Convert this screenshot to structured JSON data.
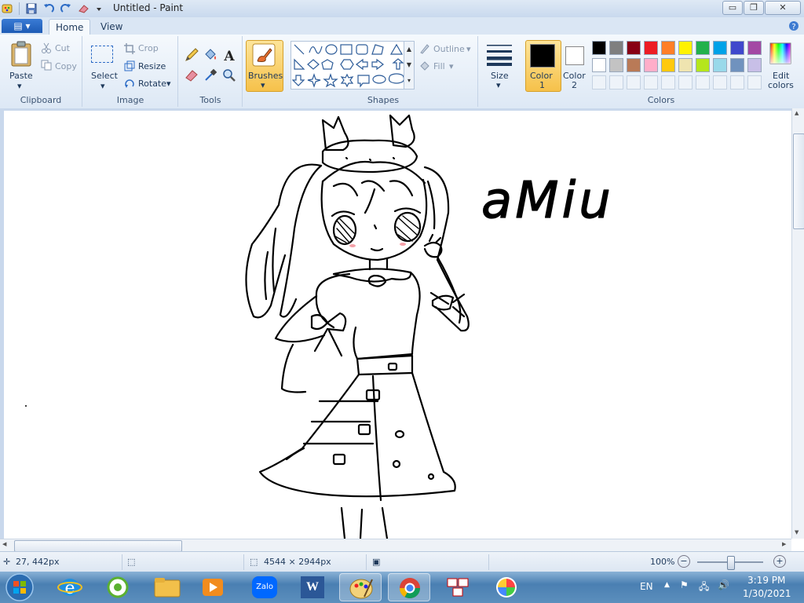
{
  "window": {
    "title": "Untitled - Paint"
  },
  "tabs": {
    "home": "Home",
    "view": "View"
  },
  "clipboard": {
    "paste": "Paste",
    "cut": "Cut",
    "copy": "Copy",
    "group": "Clipboard"
  },
  "image": {
    "select": "Select",
    "crop": "Crop",
    "resize": "Resize",
    "rotate": "Rotate",
    "group": "Image"
  },
  "tools": {
    "group": "Tools",
    "text_tool": "A"
  },
  "brushes": {
    "label": "Brushes"
  },
  "shapes": {
    "outline": "Outline",
    "fill": "Fill",
    "group": "Shapes"
  },
  "size": {
    "label": "Size"
  },
  "colors": {
    "color1": "Color",
    "color1_num": "1",
    "color2": "Color",
    "color2_num": "2",
    "edit_line1": "Edit",
    "edit_line2": "colors",
    "group": "Colors",
    "palette_row1": [
      "#000000",
      "#7f7f7f",
      "#880015",
      "#ed1c24",
      "#ff7f27",
      "#fff200",
      "#22b14c",
      "#00a2e8",
      "#3f48cc",
      "#a349a4"
    ],
    "palette_row2": [
      "#ffffff",
      "#c3c3c3",
      "#b97a57",
      "#ffaec9",
      "#ffc90e",
      "#efe4b0",
      "#b5e61d",
      "#99d9ea",
      "#7092be",
      "#c8bfe7"
    ],
    "color1_value": "#000000",
    "color2_value": "#ffffff"
  },
  "drawing": {
    "signature": "aMiu"
  },
  "status": {
    "cursor_pos": "27, 442px",
    "canvas_size": "4544 × 2944px",
    "zoom": "100%"
  },
  "taskbar": {
    "apps": [
      "start-orb",
      "internet-explorer",
      "coccoc",
      "file-explorer",
      "media-player",
      "zalo",
      "word",
      "paint",
      "chrome",
      "unikey",
      "color-app"
    ],
    "zalo_label": "Zalo",
    "word_label": "W",
    "lang": "EN",
    "time": "3:19 PM",
    "date": "1/30/2021"
  }
}
